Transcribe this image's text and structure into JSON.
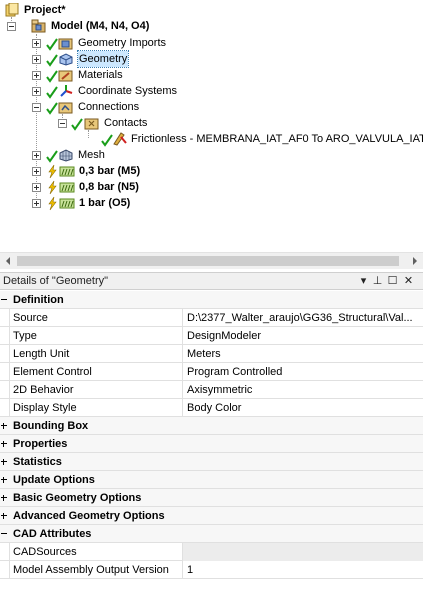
{
  "tree": {
    "project": "Project*",
    "model": "Model (M4, N4, O4)",
    "geometry_imports": "Geometry Imports",
    "geometry": "Geometry",
    "materials": "Materials",
    "coordinate_systems": "Coordinate Systems",
    "connections": "Connections",
    "contacts": "Contacts",
    "contact_region": "Frictionless - MEMBRANA_IAT_AF0 To ARO_VALVULA_IAT_A",
    "mesh": "Mesh",
    "system_m5": "0,3 bar (M5)",
    "system_n5": "0,8 bar (N5)",
    "system_o5": "1 bar (O5)"
  },
  "details": {
    "title": "Details of \"Geometry\"",
    "buttons": {
      "menu": "▾",
      "pin": "⊥",
      "restore": "☐",
      "close": "✕"
    },
    "definition": {
      "label": "Definition",
      "rows": [
        {
          "key": "Source",
          "value": "D:\\2377_Walter_araujo\\GG36_Structural\\Val..."
        },
        {
          "key": "Type",
          "value": "DesignModeler"
        },
        {
          "key": "Length Unit",
          "value": "Meters"
        },
        {
          "key": "Element Control",
          "value": "Program Controlled"
        },
        {
          "key": "2D Behavior",
          "value": "Axisymmetric"
        },
        {
          "key": "Display Style",
          "value": "Body Color"
        }
      ]
    },
    "collapsed": [
      "Bounding Box",
      "Properties",
      "Statistics",
      "Update Options",
      "Basic Geometry Options",
      "Advanced Geometry Options"
    ],
    "cad": {
      "label": "CAD Attributes",
      "rows": [
        {
          "key": "CADSources",
          "value": ""
        },
        {
          "key": "Model Assembly Output Version",
          "value": "1"
        }
      ]
    }
  },
  "colors": {
    "selection": "#cce8ff",
    "check": "#1a9e1a"
  }
}
